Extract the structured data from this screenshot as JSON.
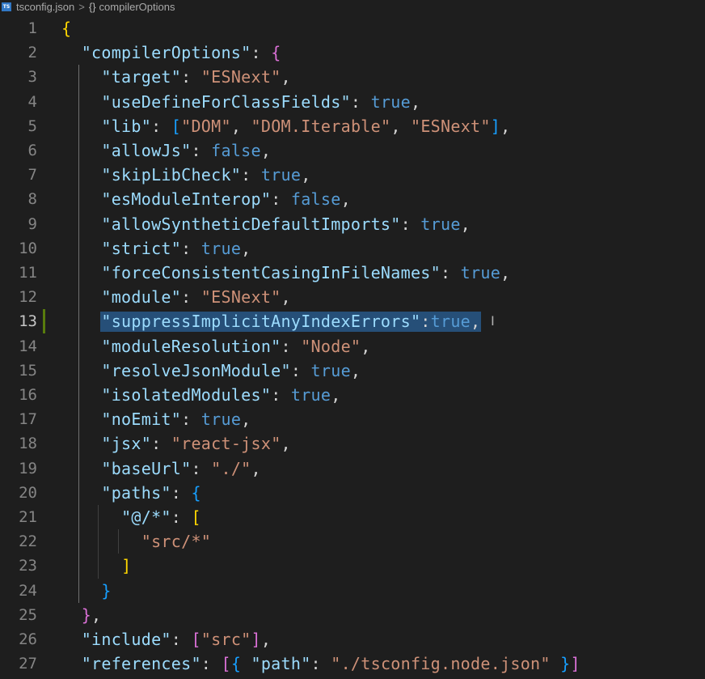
{
  "breadcrumb": {
    "file_icon": "TS",
    "file_name": "tsconfig.json",
    "separator": ">",
    "symbol_icon": "{}",
    "symbol": "compilerOptions"
  },
  "editor": {
    "active_line": 13,
    "selection_text": "\"suppressImplicitAnyIndexErrors\":true,",
    "lines": [
      {
        "n": "1",
        "text": "{"
      },
      {
        "n": "2",
        "text": "  \"compilerOptions\": {"
      },
      {
        "n": "3",
        "text": "    \"target\": \"ESNext\","
      },
      {
        "n": "4",
        "text": "    \"useDefineForClassFields\": true,"
      },
      {
        "n": "5",
        "text": "    \"lib\": [\"DOM\", \"DOM.Iterable\", \"ESNext\"],"
      },
      {
        "n": "6",
        "text": "    \"allowJs\": false,"
      },
      {
        "n": "7",
        "text": "    \"skipLibCheck\": true,"
      },
      {
        "n": "8",
        "text": "    \"esModuleInterop\": false,"
      },
      {
        "n": "9",
        "text": "    \"allowSyntheticDefaultImports\": true,"
      },
      {
        "n": "10",
        "text": "    \"strict\": true,"
      },
      {
        "n": "11",
        "text": "    \"forceConsistentCasingInFileNames\": true,"
      },
      {
        "n": "12",
        "text": "    \"module\": \"ESNext\","
      },
      {
        "n": "13",
        "text": "    \"suppressImplicitAnyIndexErrors\":true,"
      },
      {
        "n": "14",
        "text": "    \"moduleResolution\": \"Node\","
      },
      {
        "n": "15",
        "text": "    \"resolveJsonModule\": true,"
      },
      {
        "n": "16",
        "text": "    \"isolatedModules\": true,"
      },
      {
        "n": "17",
        "text": "    \"noEmit\": true,"
      },
      {
        "n": "18",
        "text": "    \"jsx\": \"react-jsx\","
      },
      {
        "n": "19",
        "text": "    \"baseUrl\": \"./\","
      },
      {
        "n": "20",
        "text": "    \"paths\": {"
      },
      {
        "n": "21",
        "text": "      \"@/*\": ["
      },
      {
        "n": "22",
        "text": "        \"src/*\""
      },
      {
        "n": "23",
        "text": "      ]"
      },
      {
        "n": "24",
        "text": "    }"
      },
      {
        "n": "25",
        "text": "  },"
      },
      {
        "n": "26",
        "text": "  \"include\": [\"src\"],"
      },
      {
        "n": "27",
        "text": "  \"references\": [{ \"path\": \"./tsconfig.node.json\" }]"
      }
    ]
  },
  "colors": {
    "background": "#1e1e1e",
    "key": "#9cdcfe",
    "string": "#ce9178",
    "boolean": "#569cd6",
    "bracket_level1": "#ffd700",
    "bracket_level2": "#da70d6",
    "bracket_level3": "#179fff",
    "selection": "#264f78",
    "modified_bar": "#587c0c"
  },
  "icons": {
    "file_type": "typescript-file-icon",
    "symbol": "json-object-icon",
    "mouse_cursor": "text-cursor-icon"
  }
}
